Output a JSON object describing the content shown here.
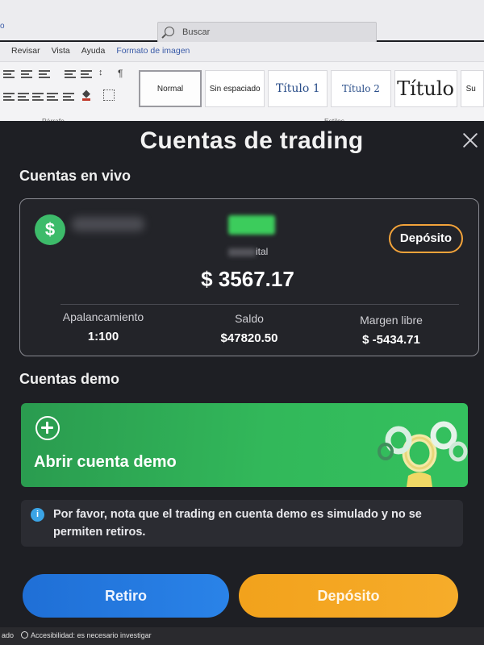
{
  "word": {
    "title_fragment": "o",
    "search_placeholder": "Buscar",
    "tabs": [
      "Revisar",
      "Vista",
      "Ayuda",
      "Formato de imagen"
    ],
    "paragraph_group_label": "Párrafo",
    "styles_group_label": "Estilos",
    "styles": [
      "Normal",
      "Sin espaciado",
      "Título 1",
      "Título 2",
      "Título",
      "Su"
    ],
    "status": {
      "left_fragment": "ado",
      "accessibility": "Accesibilidad: es necesario investigar"
    }
  },
  "modal": {
    "title": "Cuentas de trading",
    "live_section_title": "Cuentas en vivo",
    "live_account": {
      "currency_icon": "$",
      "account_type_visible": "ital",
      "balance": "$ 3567.17",
      "deposit_label": "Depósito",
      "metrics": [
        {
          "label": "Apalancamiento",
          "value": "1:100"
        },
        {
          "label": "Saldo",
          "value": "$47820.50"
        },
        {
          "label": "Margen libre",
          "value": "$ -5434.71"
        }
      ]
    },
    "demo_section_title": "Cuentas demo",
    "demo_card_label": "Abrir cuenta demo",
    "notice_icon": "i",
    "notice_text": "Por favor, nota que el trading en cuenta demo es simulado y no se permiten retiros.",
    "withdraw_label": "Retiro",
    "deposit_label": "Depósito",
    "colors": {
      "background": "#1e1f24",
      "accent_green": "#34c15e",
      "withdraw_blue": "#2a83e8",
      "deposit_orange": "#f6ac2a",
      "deposit_outline": "#f2a33a",
      "info_blue": "#3ba4e6"
    }
  }
}
